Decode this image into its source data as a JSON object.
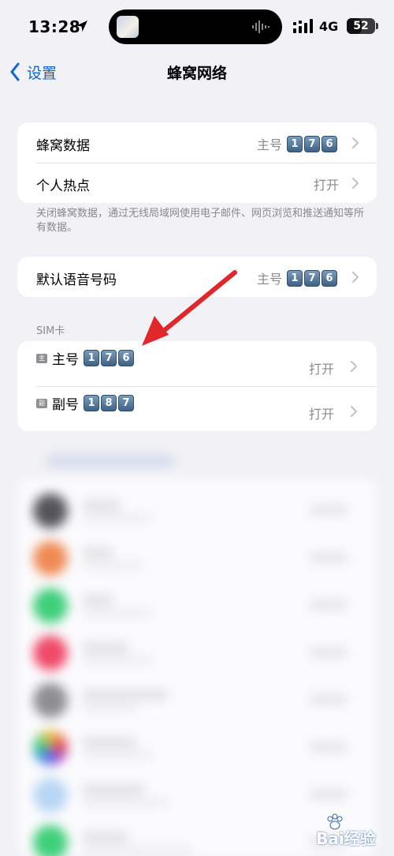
{
  "status_bar": {
    "time": "13:28",
    "network": "4G",
    "battery": "52",
    "battery_level": 0.52
  },
  "nav": {
    "back_label": "设置",
    "title": "蜂窝网络"
  },
  "group1": {
    "rows": [
      {
        "label": "蜂窝数据",
        "value": "主号",
        "number_keys": [
          "1",
          "7",
          "6"
        ]
      },
      {
        "label": "个人热点",
        "value": "打开"
      }
    ],
    "footer": "关闭蜂窝数据，通过无线局域网使用电子邮件、网页浏览和推送通知等所有数据。"
  },
  "group2": {
    "label": "默认语音号码",
    "value": "主号",
    "number_keys": [
      "1",
      "7",
      "6"
    ]
  },
  "sim_section": {
    "header": "SIM卡",
    "rows": [
      {
        "icon_text": "主",
        "label": "主号",
        "number_keys": [
          "1",
          "7",
          "6"
        ],
        "value": "打开"
      },
      {
        "icon_text": "副",
        "label": "副号",
        "number_keys": [
          "1",
          "8",
          "7"
        ],
        "value": "打开"
      }
    ]
  },
  "annotation": {
    "arrow_color": "#e0282c"
  },
  "watermark": {
    "text": "Bai经验"
  },
  "colors": {
    "background": "#f1f1f6",
    "accent": "#0a66d6",
    "secondary_text": "#8a8a8e"
  }
}
